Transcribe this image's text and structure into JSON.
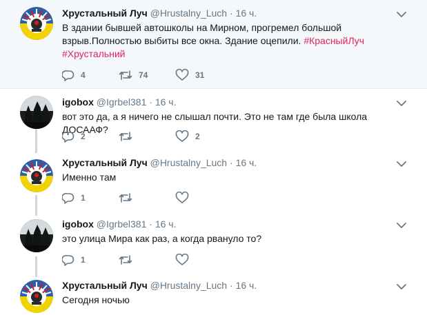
{
  "tweets": [
    {
      "author": "Хрустальный Луч",
      "handle": "@Hrustalny_Luch",
      "dot": "·",
      "time": "16 ч.",
      "line1": "В здании бывшей автошколы на Мирном,   прогремел большой",
      "line2": "взрыв.Полностью выбиты все окна. Здание оцепили.",
      "hashtag1": "#КрасныйЛуч",
      "hashtag2": "#Хрустальний",
      "replies": "4",
      "retweets": "74",
      "likes": "31"
    },
    {
      "author": "igobox",
      "handle": "@Igrbel381",
      "dot": "·",
      "time": "16 ч.",
      "text": "вот это да, а я ничего не слышал почти. Это не там где была школа ДОСААФ?",
      "replies": "2",
      "retweets": "",
      "likes": "2"
    },
    {
      "author": "Хрустальный Луч",
      "handle": "@Hrustalny_Luch",
      "dot": "·",
      "time": "16 ч.",
      "text": "Именно там",
      "replies": "1",
      "retweets": "",
      "likes": ""
    },
    {
      "author": "igobox",
      "handle": "@Igrbel381",
      "dot": "·",
      "time": "16 ч.",
      "text": "это улица Мира как раз, а когда рвануло то?",
      "replies": "1",
      "retweets": "",
      "likes": ""
    },
    {
      "author": "Хрустальный Луч",
      "handle": "@Hrustalny_Luch",
      "dot": "·",
      "time": "16 ч.",
      "text": "Сегодня ночью"
    }
  ],
  "colors": {
    "hashtag": "#e0245e",
    "meta": "#657786",
    "thread_line": "#ccd6dd",
    "first_bg": "#f5f8fa"
  },
  "icons": [
    "reply-icon",
    "retweet-icon",
    "like-icon",
    "caret-down-icon"
  ]
}
